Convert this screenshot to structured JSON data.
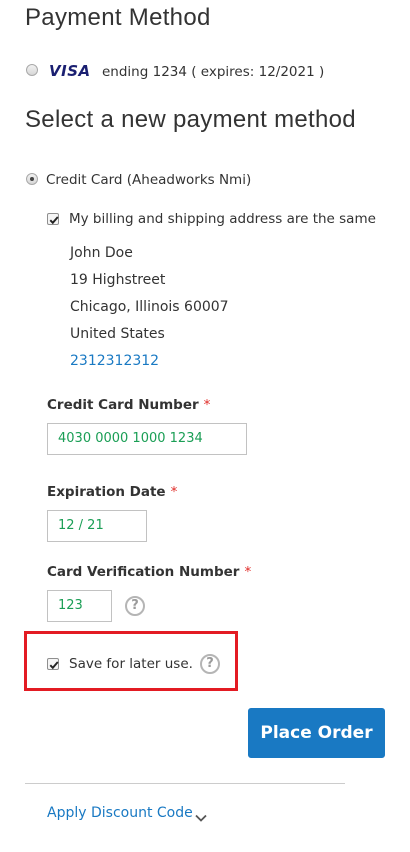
{
  "saved_payment": {
    "heading": "Payment Method",
    "card_brand": "VISA",
    "card_details": "ending 1234 ( expires: 12/2021 )"
  },
  "new_payment": {
    "heading": "Select a new payment method",
    "method_label": "Credit Card (Aheadworks Nmi)",
    "same_address_label": "My billing and shipping address are the same",
    "address": {
      "name": "John Doe",
      "street": "19 Highstreet",
      "city": "Chicago, Illinois 60007",
      "country": "United States",
      "phone": "2312312312"
    },
    "cc_number": {
      "label": "Credit Card Number",
      "required": "*",
      "value": "4030 0000 1000 1234"
    },
    "expiration": {
      "label": "Expiration Date",
      "required": "*",
      "value": "12 / 21"
    },
    "cvv": {
      "label": "Card Verification Number",
      "required": "*",
      "value": "123",
      "help": "?"
    },
    "save_for_later": {
      "label": "Save for later use.",
      "help": "?"
    },
    "place_order_label": "Place Order",
    "discount_label": "Apply Discount Code"
  },
  "colors": {
    "primary": "#1979c3",
    "required": "#e02b27",
    "highlight": "#e31b23",
    "input_text": "#1a9e55"
  }
}
